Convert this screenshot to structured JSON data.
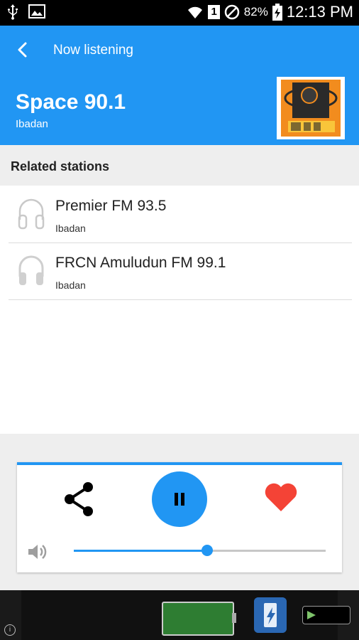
{
  "status_bar": {
    "battery_percent": "82%",
    "time": "12:13 PM",
    "sim_slot": "1"
  },
  "header": {
    "nav_title": "Now listening",
    "station_name": "Space 90.1",
    "station_city": "Ibadan",
    "color": "#2196f3"
  },
  "related": {
    "heading": "Related stations",
    "items": [
      {
        "name": "Premier FM 93.5",
        "city": "Ibadan",
        "icon": "headphones-outline-icon"
      },
      {
        "name": "FRCN Amuludun FM 99.1",
        "city": "Ibadan",
        "icon": "headphones-filled-icon"
      }
    ]
  },
  "player": {
    "state": "playing",
    "volume_level": 0.53,
    "favorite": true,
    "accent": "#2196f3",
    "heart_color": "#f44336"
  }
}
